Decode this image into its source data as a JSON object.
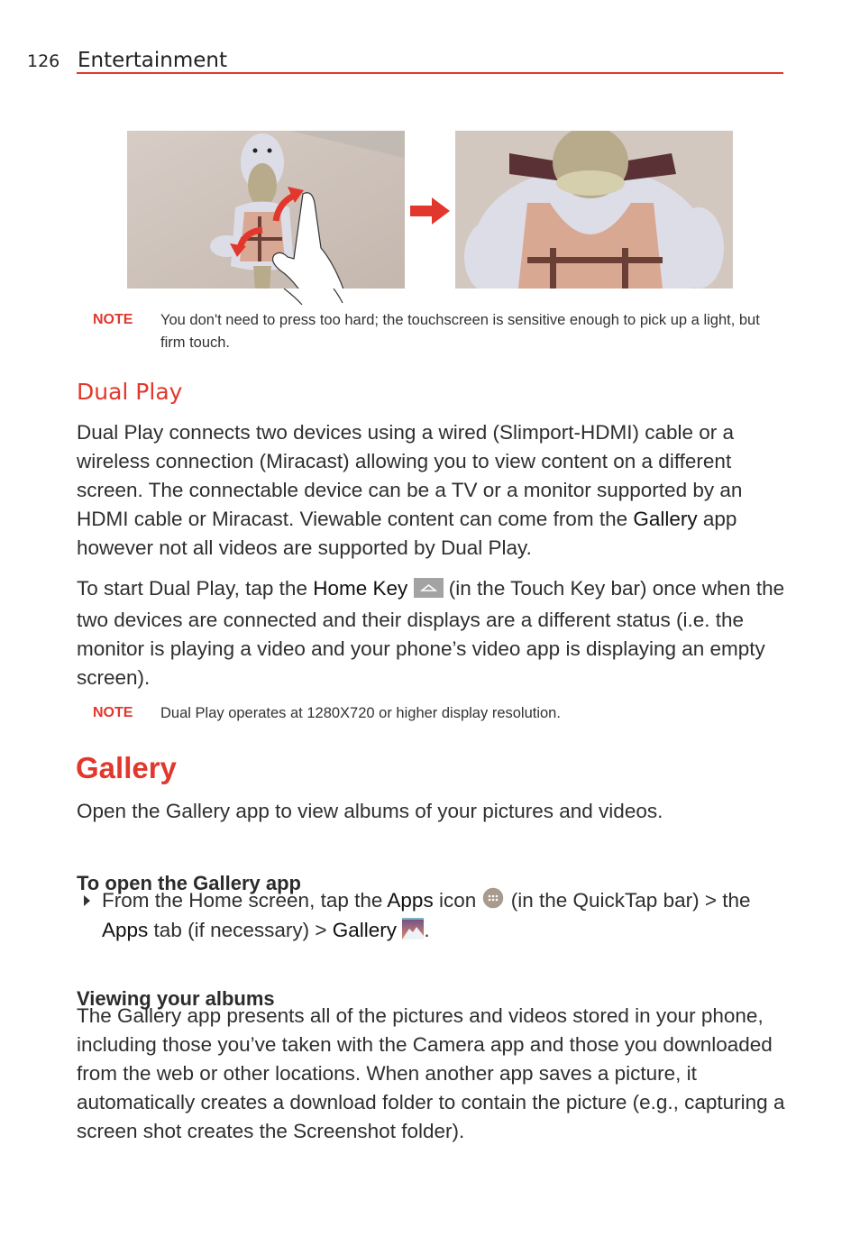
{
  "header": {
    "page_number": "126",
    "section": "Entertainment"
  },
  "figure": {
    "left_image": "pinch-zoom-gesture-on-duck-figurine",
    "right_image": "zoomed-duck-figurine",
    "arrow": "right-arrow-icon"
  },
  "note1": {
    "label": "NOTE",
    "text": "You don't need to press too hard; the touchscreen is sensitive enough to pick up a light, but firm touch."
  },
  "dual_play": {
    "heading": "Dual Play",
    "p1": [
      "Dual Play connects two devices using a wired (Slimport-HDMI) cable or a wireless connection (Miracast) allowing you to view content on a different screen. The connectable device can be a TV or a monitor supported by an HDMI cable or Miracast. Viewable content can come from the ",
      "Gallery",
      " app however not all videos are supported by Dual Play."
    ],
    "p2": [
      "To start Dual Play, tap the ",
      "Home Key",
      " (in the Touch Key bar) once when the two devices are connected and their displays are a different status (i.e. the monitor is playing a video and your phone’s video app is displaying an empty screen)."
    ],
    "note": {
      "label": "NOTE",
      "text": "Dual Play operates at 1280X720 or higher display resolution."
    }
  },
  "gallery": {
    "heading": "Gallery",
    "intro": "Open the Gallery app to view albums of your pictures and videos.",
    "open_heading": "To open the Gallery app",
    "open_step": [
      "From the Home screen, tap the ",
      "Apps",
      " icon ",
      " (in the QuickTap bar) > the ",
      "Apps",
      " tab (if necessary) > ",
      "Gallery",
      "."
    ],
    "albums_heading": "Viewing your albums",
    "albums_text": "The Gallery app presents all of the pictures and videos stored in your phone, including those you’ve taken with the Camera app and those you downloaded from the web or other locations. When another app saves a picture, it automatically creates a download folder to contain the picture (e.g., capturing a screen shot creates the Screenshot folder)."
  },
  "colors": {
    "accent": "#e2372c",
    "text": "#2f2f2f"
  }
}
